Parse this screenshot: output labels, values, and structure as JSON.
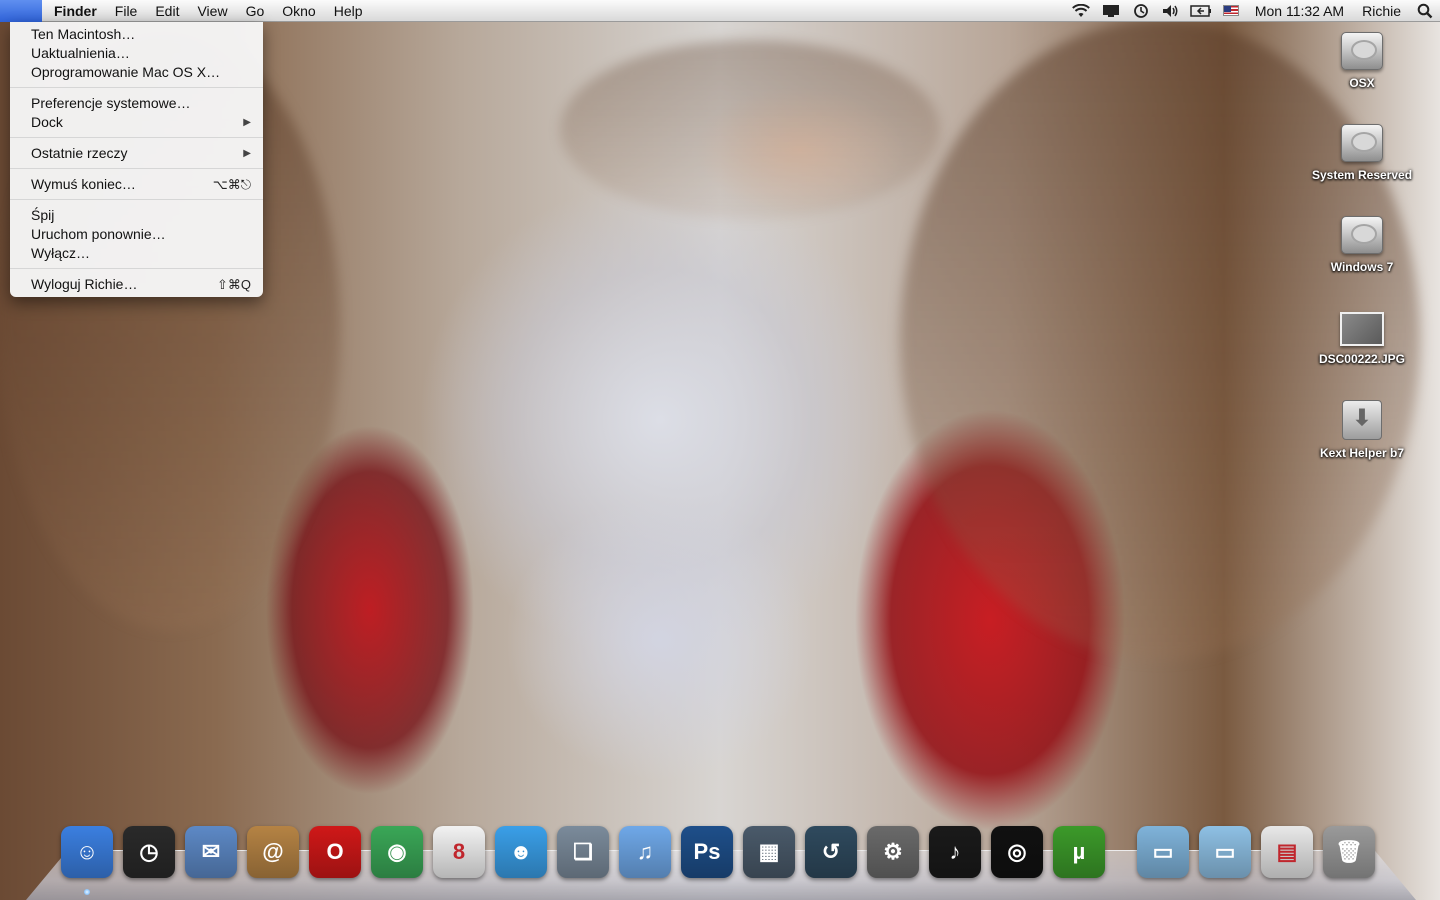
{
  "menubar": {
    "app_name": "Finder",
    "menus": [
      "File",
      "Edit",
      "View",
      "Go",
      "Okno",
      "Help"
    ],
    "clock": "Mon 11:32 AM",
    "user": "Richie",
    "status_icons": [
      "wifi-icon",
      "display-icon",
      "time-machine-icon",
      "volume-icon",
      "battery-icon",
      "us-flag-icon",
      "spotlight-icon"
    ]
  },
  "apple_menu": {
    "items": [
      {
        "label": "Ten Macintosh…",
        "shortcut": ""
      },
      {
        "label": "Uaktualnienia…",
        "shortcut": ""
      },
      {
        "label": "Oprogramowanie Mac OS X…",
        "shortcut": ""
      },
      {
        "label": "Preferencje systemowe…",
        "shortcut": ""
      },
      {
        "label": "Dock",
        "shortcut": "▶"
      },
      {
        "label": "Ostatnie rzeczy",
        "shortcut": "▶"
      },
      {
        "label": "Wymuś koniec…",
        "shortcut": "⌥⌘⎋"
      },
      {
        "label": "Śpij",
        "shortcut": ""
      },
      {
        "label": "Uruchom ponownie…",
        "shortcut": ""
      },
      {
        "label": "Wyłącz…",
        "shortcut": ""
      },
      {
        "label": "Wyloguj Richie…",
        "shortcut": "⇧⌘Q"
      }
    ]
  },
  "desktop": {
    "icons": [
      {
        "label": "OSX",
        "kind": "disk"
      },
      {
        "label": "System Reserved",
        "kind": "disk"
      },
      {
        "label": "Windows 7",
        "kind": "disk"
      },
      {
        "label": "DSC00222.JPG",
        "kind": "photo"
      },
      {
        "label": "Kext Helper b7",
        "kind": "kext"
      }
    ]
  },
  "dock": {
    "apps": [
      {
        "name": "finder-icon",
        "glyph": "☺",
        "color": "#3b7fe0"
      },
      {
        "name": "dashboard-icon",
        "glyph": "◷",
        "color": "#2a2a2a"
      },
      {
        "name": "mail-icon",
        "glyph": "✉",
        "color": "#5d89c6"
      },
      {
        "name": "address-book-icon",
        "glyph": "@",
        "color": "#b58344"
      },
      {
        "name": "opera-icon",
        "glyph": "O",
        "color": "#d01818"
      },
      {
        "name": "chrome-icon",
        "glyph": "◉",
        "color": "#3aa757"
      },
      {
        "name": "ical-icon",
        "glyph": "8",
        "color": "#f2f2f2"
      },
      {
        "name": "messenger-icon",
        "glyph": "☻",
        "color": "#3a9fe8"
      },
      {
        "name": "iphoto-icon",
        "glyph": "❏",
        "color": "#7b8b9b"
      },
      {
        "name": "itunes-icon",
        "glyph": "♫",
        "color": "#6fa8e8"
      },
      {
        "name": "photoshop-icon",
        "glyph": "Ps",
        "color": "#1e4f8a"
      },
      {
        "name": "spaces-icon",
        "glyph": "▦",
        "color": "#4a5a6a"
      },
      {
        "name": "time-machine-icon",
        "glyph": "↺",
        "color": "#2f4a5e"
      },
      {
        "name": "system-preferences-icon",
        "glyph": "⚙",
        "color": "#6a6a6a"
      },
      {
        "name": "music-app-icon",
        "glyph": "♪",
        "color": "#1a1a1a"
      },
      {
        "name": "vinyl-icon",
        "glyph": "◎",
        "color": "#111111"
      },
      {
        "name": "utorrent-icon",
        "glyph": "µ",
        "color": "#3c9a2a"
      }
    ],
    "stacks": [
      {
        "name": "folder-icon",
        "glyph": "▭",
        "color": "#7fb3da"
      },
      {
        "name": "documents-folder-icon",
        "glyph": "▭",
        "color": "#8ec0e4"
      },
      {
        "name": "downloads-stack-icon",
        "glyph": "▤",
        "color": "#e8e8e8"
      },
      {
        "name": "trash-icon",
        "glyph": "🗑",
        "color": "#9a9a9a"
      }
    ]
  }
}
